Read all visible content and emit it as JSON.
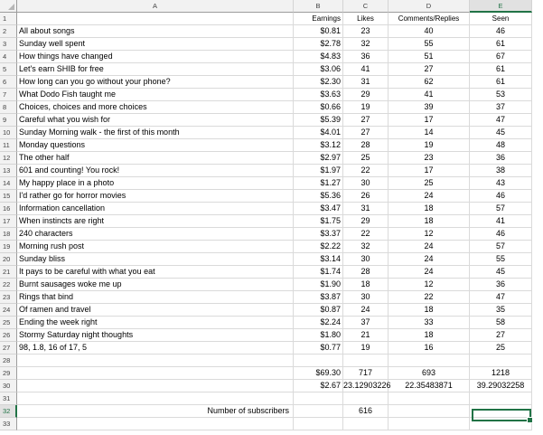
{
  "columns": [
    "A",
    "B",
    "C",
    "D",
    "E"
  ],
  "headers": {
    "earnings": "Earnings",
    "likes": "Likes",
    "comments": "Comments/Replies",
    "seen": "Seen"
  },
  "rows": [
    {
      "num": "1"
    },
    {
      "num": "2",
      "title": "All about songs",
      "earnings": "$0.81",
      "likes": "23",
      "comments": "40",
      "seen": "46"
    },
    {
      "num": "3",
      "title": "Sunday well spent",
      "earnings": "$2.78",
      "likes": "32",
      "comments": "55",
      "seen": "61"
    },
    {
      "num": "4",
      "title": "How things have changed",
      "earnings": "$4.83",
      "likes": "36",
      "comments": "51",
      "seen": "67"
    },
    {
      "num": "5",
      "title": "Let's earn SHIB for free",
      "earnings": "$3.06",
      "likes": "41",
      "comments": "27",
      "seen": "61"
    },
    {
      "num": "6",
      "title": "How long can you go without your phone?",
      "earnings": "$2.30",
      "likes": "31",
      "comments": "62",
      "seen": "61"
    },
    {
      "num": "7",
      "title": "What Dodo Fish taught me",
      "earnings": "$3.63",
      "likes": "29",
      "comments": "41",
      "seen": "53"
    },
    {
      "num": "8",
      "title": "Choices, choices and more choices",
      "earnings": "$0.66",
      "likes": "19",
      "comments": "39",
      "seen": "37"
    },
    {
      "num": "9",
      "title": "Careful what you wish for",
      "earnings": "$5.39",
      "likes": "27",
      "comments": "17",
      "seen": "47"
    },
    {
      "num": "10",
      "title": "Sunday Morning walk - the first of this month",
      "earnings": "$4.01",
      "likes": "27",
      "comments": "14",
      "seen": "45"
    },
    {
      "num": "11",
      "title": "Monday questions",
      "earnings": "$3.12",
      "likes": "28",
      "comments": "19",
      "seen": "48"
    },
    {
      "num": "12",
      "title": "The other half",
      "earnings": "$2.97",
      "likes": "25",
      "comments": "23",
      "seen": "36"
    },
    {
      "num": "13",
      "title": "601 and counting! You rock!",
      "earnings": "$1.97",
      "likes": "22",
      "comments": "17",
      "seen": "38"
    },
    {
      "num": "14",
      "title": "My happy place in a photo",
      "earnings": "$1.27",
      "likes": "30",
      "comments": "25",
      "seen": "43"
    },
    {
      "num": "15",
      "title": "I'd rather go for horror movies",
      "earnings": "$5.36",
      "likes": "26",
      "comments": "24",
      "seen": "46"
    },
    {
      "num": "16",
      "title": "Information cancellation",
      "earnings": "$3.47",
      "likes": "31",
      "comments": "18",
      "seen": "57"
    },
    {
      "num": "17",
      "title": "When instincts are right",
      "earnings": "$1.75",
      "likes": "29",
      "comments": "18",
      "seen": "41"
    },
    {
      "num": "18",
      "title": "240 characters",
      "earnings": "$3.37",
      "likes": "22",
      "comments": "12",
      "seen": "46"
    },
    {
      "num": "19",
      "title": "Morning rush post",
      "earnings": "$2.22",
      "likes": "32",
      "comments": "24",
      "seen": "57"
    },
    {
      "num": "20",
      "title": "Sunday bliss",
      "earnings": "$3.14",
      "likes": "30",
      "comments": "24",
      "seen": "55"
    },
    {
      "num": "21",
      "title": "It pays to be careful with what you eat",
      "earnings": "$1.74",
      "likes": "28",
      "comments": "24",
      "seen": "45"
    },
    {
      "num": "22",
      "title": "Burnt sausages woke me up",
      "earnings": "$1.90",
      "likes": "18",
      "comments": "12",
      "seen": "36"
    },
    {
      "num": "23",
      "title": "Rings that bind",
      "earnings": "$3.87",
      "likes": "30",
      "comments": "22",
      "seen": "47"
    },
    {
      "num": "24",
      "title": "Of ramen and travel",
      "earnings": "$0.87",
      "likes": "24",
      "comments": "18",
      "seen": "35"
    },
    {
      "num": "25",
      "title": "Ending the week right",
      "earnings": "$2.24",
      "likes": "37",
      "comments": "33",
      "seen": "58"
    },
    {
      "num": "26",
      "title": "Stormy Saturday night thoughts",
      "earnings": "$1.80",
      "likes": "21",
      "comments": "18",
      "seen": "27"
    },
    {
      "num": "27",
      "title": "98, 1.8, 16 of 17, 5",
      "earnings": "$0.77",
      "likes": "19",
      "comments": "16",
      "seen": "25"
    },
    {
      "num": "28"
    },
    {
      "num": "29",
      "earnings": "$69.30",
      "likes": "717",
      "comments": "693",
      "seen": "1218"
    },
    {
      "num": "30",
      "earnings": "$2.67",
      "likes": "23.12903226",
      "comments": "22.35483871",
      "seen": "39.29032258"
    },
    {
      "num": "31"
    },
    {
      "num": "32",
      "label": "Number of subscribers",
      "likes": "616"
    },
    {
      "num": "33"
    }
  ]
}
